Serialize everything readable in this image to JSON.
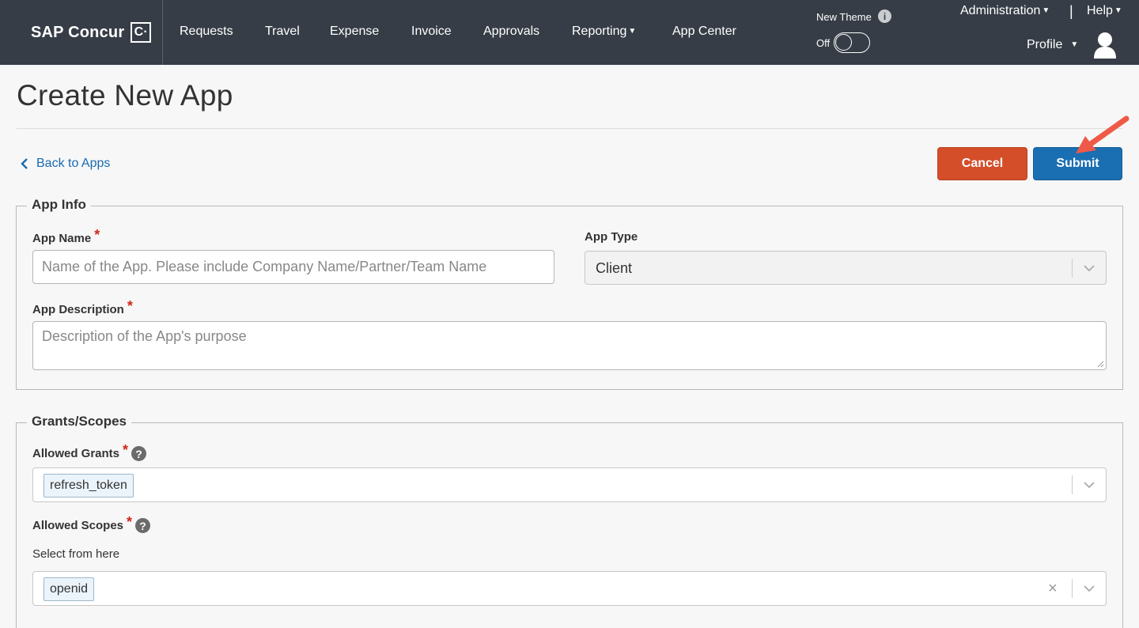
{
  "nav": {
    "brand": "SAP Concur",
    "brand_mark": "C·",
    "items": [
      "Requests",
      "Travel",
      "Expense",
      "Invoice",
      "Approvals",
      "Reporting",
      "App Center"
    ],
    "new_theme": "New Theme",
    "info_glyph": "i",
    "theme_state": "Off",
    "administration": "Administration",
    "separator": "|",
    "help": "Help",
    "profile": "Profile"
  },
  "page": {
    "title": "Create New App",
    "back": "Back to Apps",
    "cancel": "Cancel",
    "submit": "Submit"
  },
  "app_info": {
    "legend": "App Info",
    "app_name_label": "App Name",
    "app_name_placeholder": "Name of the App. Please include Company Name/Partner/Team Name",
    "app_type_label": "App Type",
    "app_type_value": "Client",
    "app_desc_label": "App Description",
    "app_desc_placeholder": "Description of the App's purpose",
    "required_mark": "*"
  },
  "grants": {
    "legend": "Grants/Scopes",
    "allowed_grants_label": "Allowed Grants",
    "grants_tags": [
      "refresh_token"
    ],
    "allowed_scopes_label": "Allowed Scopes",
    "scopes_hint": "Select from here",
    "scopes_tags": [
      "openid"
    ],
    "help_glyph": "?",
    "clear_glyph": "×"
  },
  "colors": {
    "nav_bg": "#363d46",
    "cancel": "#d44e2a",
    "submit": "#1a6fb3",
    "link": "#1a6bb0",
    "required": "#d0271d",
    "annotation_arrow": "#ef5a48"
  }
}
